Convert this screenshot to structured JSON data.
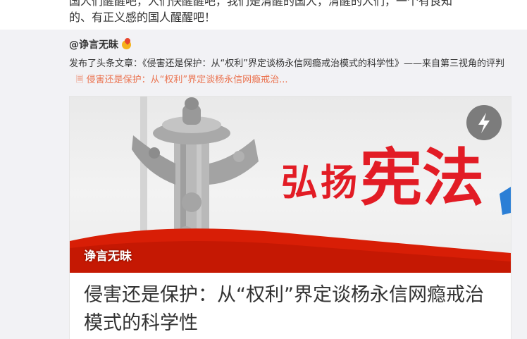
{
  "top_post": {
    "line1": "国人们醒醒吧，人们快醒醒吧，我们是清醒的国人，清醒的人们，一个有良知",
    "line2": "的、有正义感的国人醒醒吧！"
  },
  "repost": {
    "author": "@诤言无昧",
    "description": "发布了头条文章：《侵害还是保护：从“权利”界定谈杨永信网瘾戒治模式的科学性》——来自第三视角的评判",
    "link_icon": "🗏",
    "link_text": "侵害还是保护：从“权利”界定谈杨永信网瘾戒治..."
  },
  "card": {
    "watermark": "诤言无昧",
    "slogan_small": "弘扬",
    "slogan_big": "宪法",
    "title": "侵害还是保护：从“权利”界定谈杨永信网瘾戒治模式的科学性"
  },
  "colors": {
    "accent_link": "#eb7350",
    "slogan_red": "#e21c25",
    "flag_red": "#d81e06"
  },
  "icons": {
    "author_badge": "fire-emoji-icon",
    "article_link": "article-icon",
    "play": "lightning-icon"
  }
}
